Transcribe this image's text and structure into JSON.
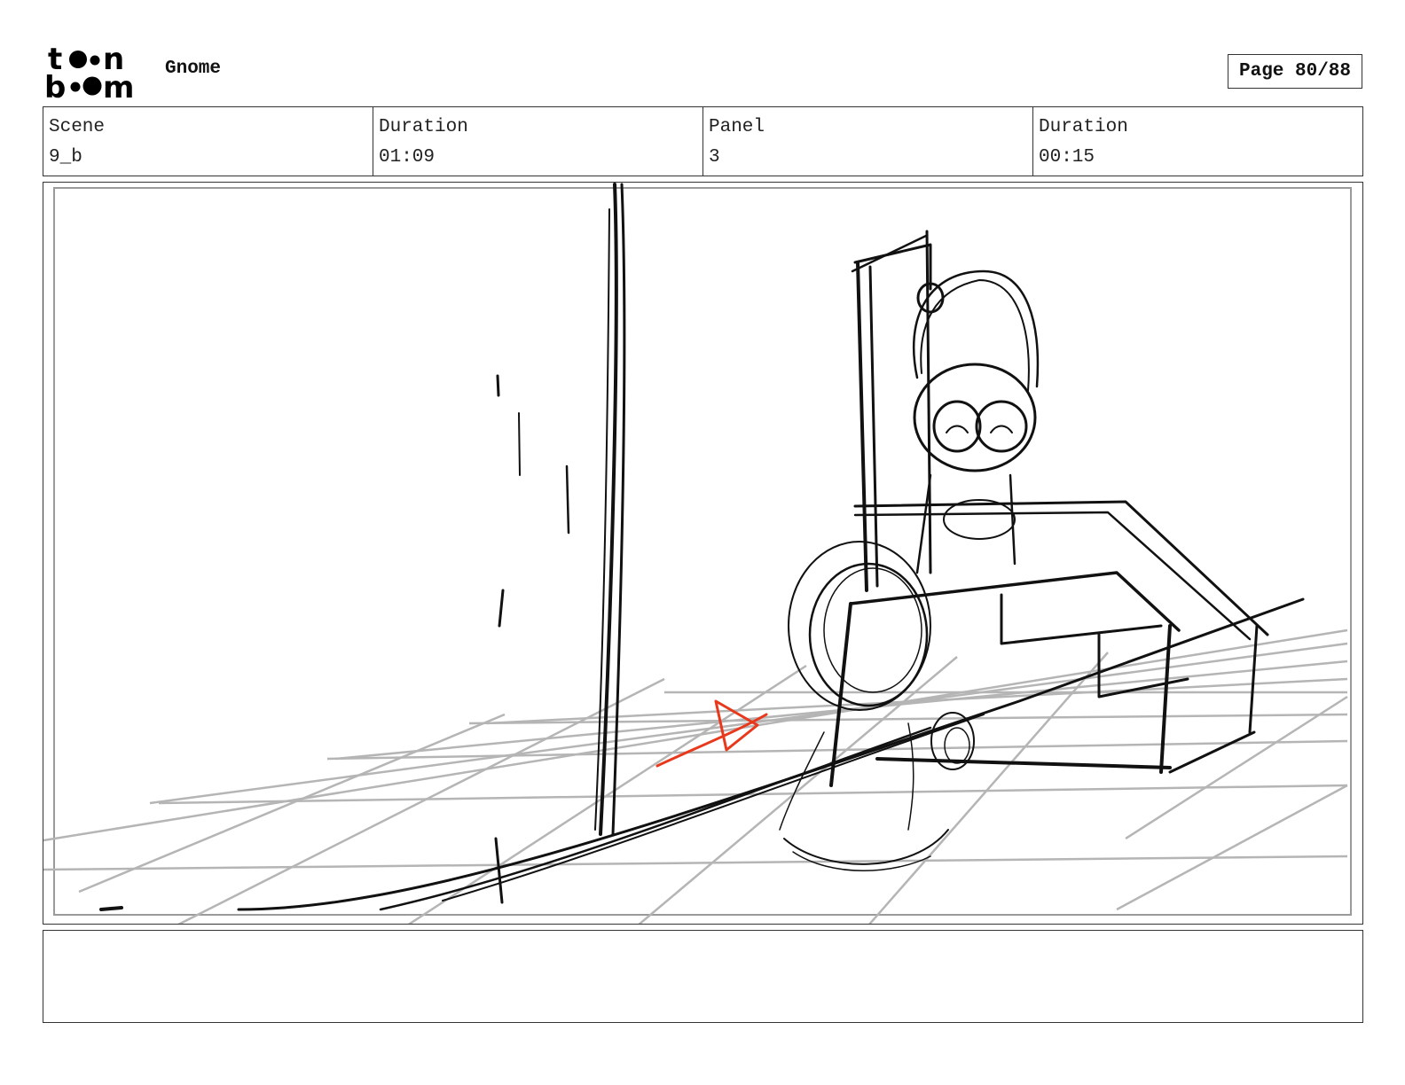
{
  "header": {
    "logo_text_top": "toon",
    "logo_text_bottom": "boom",
    "project_title": "Gnome",
    "page_label": "Page 80/88"
  },
  "info": {
    "scene_label": "Scene",
    "scene_value": "9_b",
    "scene_duration_label": "Duration",
    "scene_duration_value": "01:09",
    "panel_label": "Panel",
    "panel_value": "3",
    "panel_duration_label": "Duration",
    "panel_duration_value": "00:15"
  },
  "panel": {
    "sketch_stroke_color": "#111111",
    "grid_color": "#b5b5b5",
    "motion_arrow_color": "#e8391c",
    "safe_frame_color": "#9a9a9a"
  },
  "notes": {
    "text": ""
  }
}
